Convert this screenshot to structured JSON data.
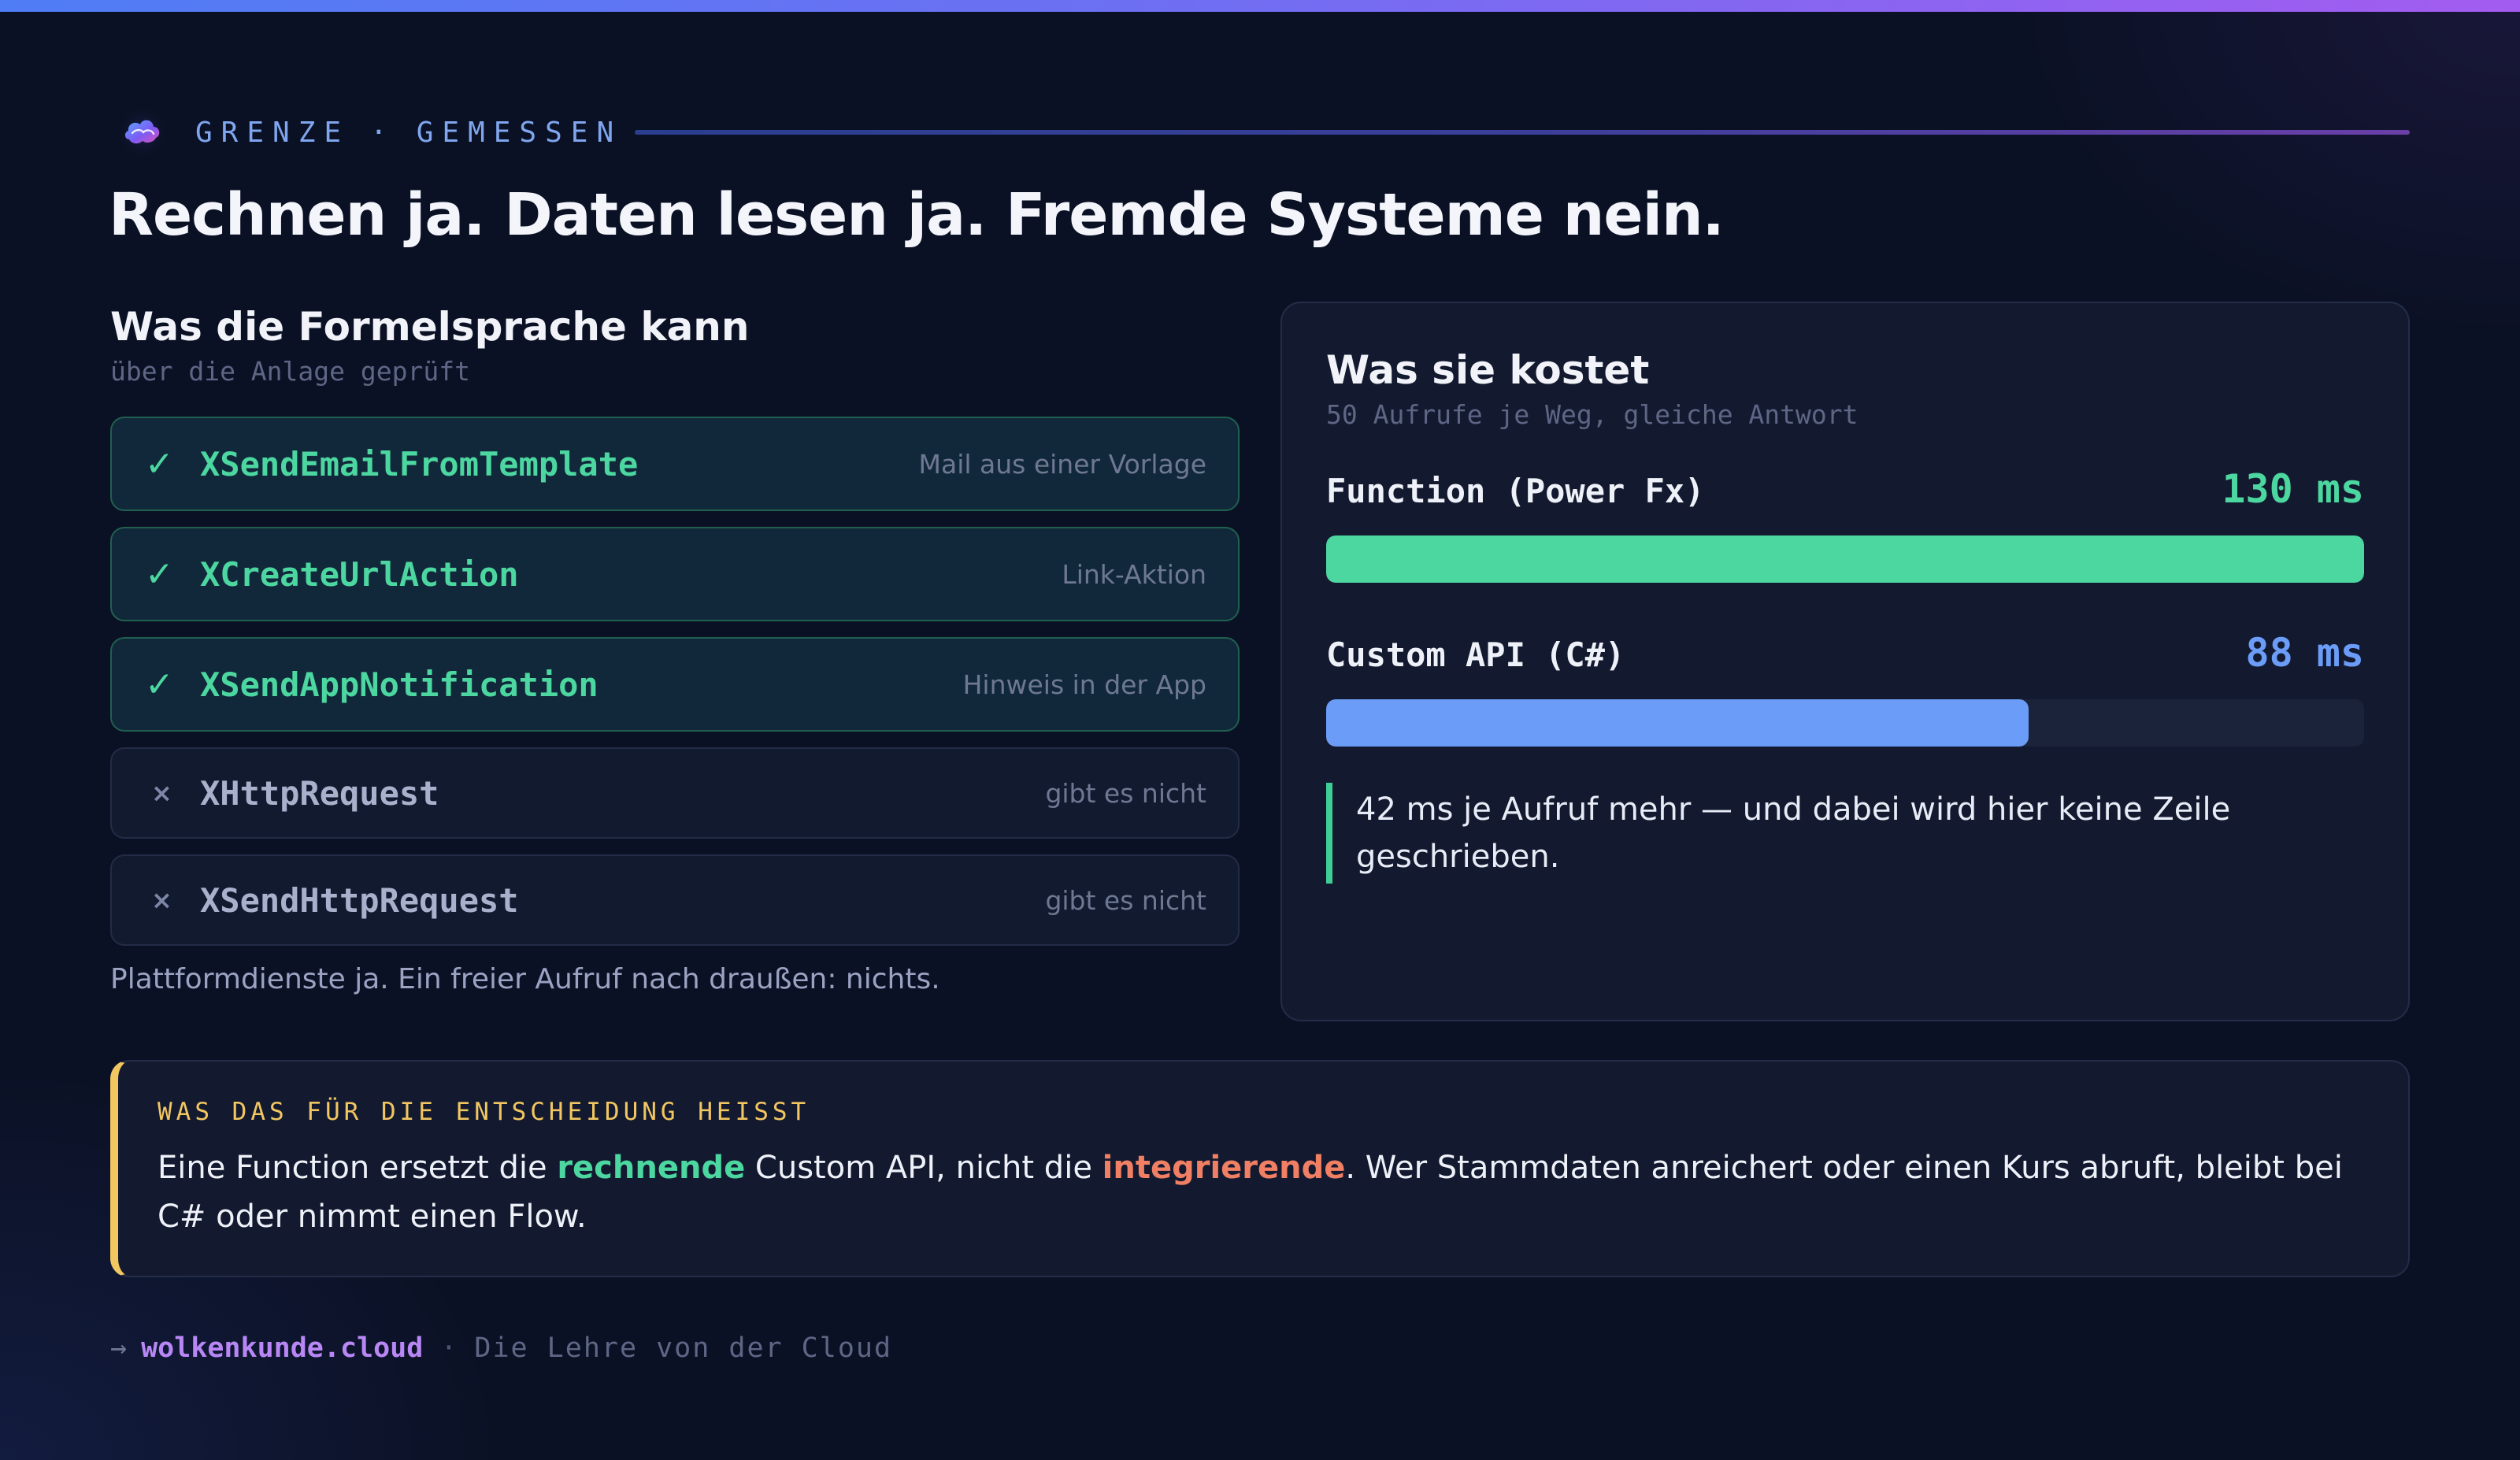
{
  "eyebrow": {
    "left": "GRENZE",
    "separator": "·",
    "right": "GEMESSEN"
  },
  "title": "Rechnen ja. Daten lesen ja. Fremde Systeme nein.",
  "capabilities": {
    "title": "Was die Formelsprache kann",
    "subtitle": "über die Anlage geprüft",
    "items": [
      {
        "mark": "✓",
        "name": "XSendEmailFromTemplate",
        "desc": "Mail aus einer Vorlage"
      },
      {
        "mark": "✓",
        "name": "XCreateUrlAction",
        "desc": "Link-Aktion"
      },
      {
        "mark": "✓",
        "name": "XSendAppNotification",
        "desc": "Hinweis in der App"
      },
      {
        "mark": "×",
        "name": "XHttpRequest",
        "desc": "gibt es nicht"
      },
      {
        "mark": "×",
        "name": "XSendHttpRequest",
        "desc": "gibt es nicht"
      }
    ],
    "note": "Plattformdienste ja. Ein freier Aufruf nach draußen: nichts."
  },
  "cost": {
    "title": "Was sie kostet",
    "subtitle": "50 Aufrufe je Weg, gleiche Antwort",
    "metrics": [
      {
        "label": "Function (Power Fx)",
        "value_text": "130 ms",
        "value": 130,
        "color": "#4cd6a0"
      },
      {
        "label": "Custom API (C#)",
        "value_text": "88 ms",
        "value": 88,
        "color": "#6b9cf7"
      }
    ],
    "max": 130,
    "note": "42 ms je Aufruf mehr — und dabei wird hier keine Zeile geschrieben."
  },
  "decision": {
    "label": "WAS DAS FÜR DIE ENTSCHEIDUNG HEISST",
    "part1": "Eine Function ersetzt die ",
    "highlight1": "rechnende",
    "part2": " Custom API, nicht die ",
    "highlight2": "integrierende",
    "part3": ". Wer Stammdaten anreichert oder einen Kurs abruft, bleibt bei C# oder nimmt einen Flow."
  },
  "footer": {
    "arrow": "→",
    "site": "wolkenkunde.cloud",
    "separator": "·",
    "tagline": "Die Lehre von der Cloud"
  },
  "colors": {
    "accent_green": "#4cd6a0",
    "accent_blue": "#6b9cf7",
    "accent_yellow": "#f2c660",
    "accent_red": "#f07f63",
    "accent_purple": "#b887f5"
  },
  "icons": {
    "logo": "cloud-logo-icon",
    "check": "check-icon",
    "cross": "cross-icon",
    "arrow": "arrow-right-icon"
  }
}
